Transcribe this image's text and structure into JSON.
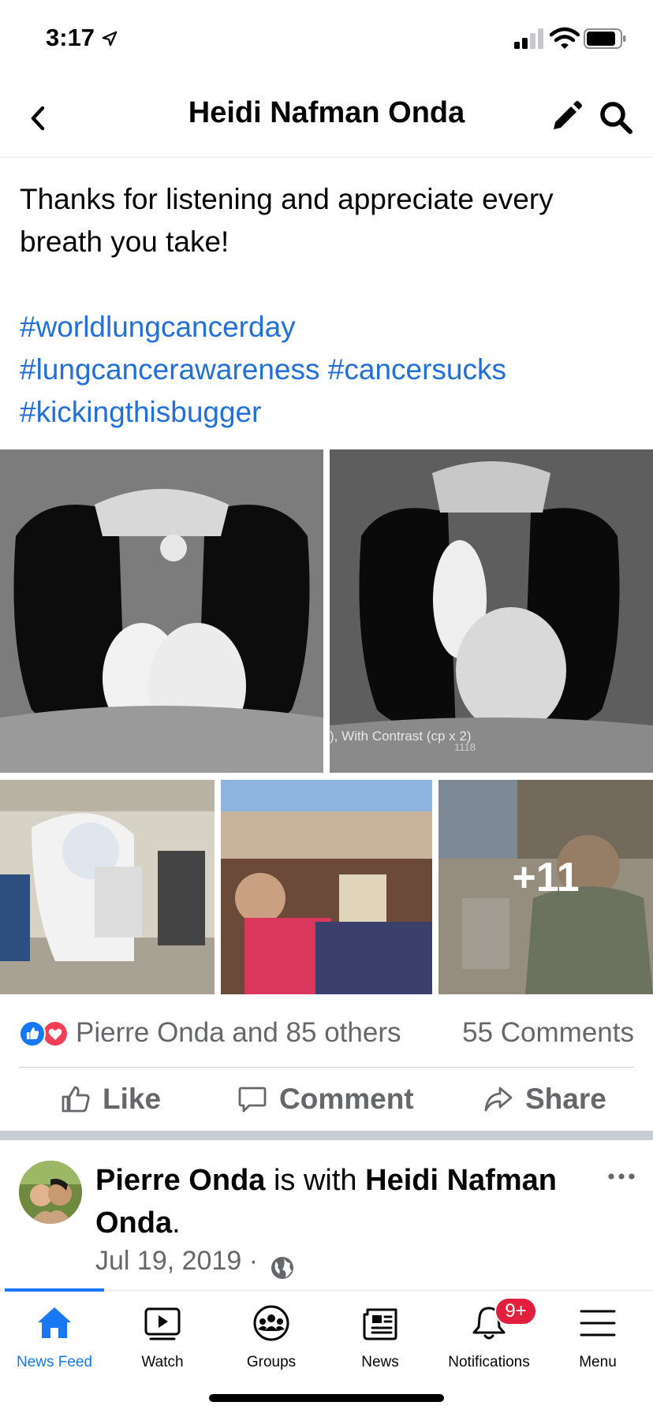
{
  "status_bar": {
    "time": "3:17",
    "icons": [
      "location-arrow-icon",
      "cellular-signal-icon",
      "wifi-icon",
      "battery-icon"
    ]
  },
  "header": {
    "title": "Heidi Nafman Onda",
    "back_icon": "chevron-left-icon",
    "edit_icon": "pencil-icon",
    "search_icon": "search-icon"
  },
  "post": {
    "text_lines": [
      "Thanks for listening and appreciate every",
      "breath you take!"
    ],
    "hashtags": {
      "line1": [
        "#worldlungcancerday"
      ],
      "line2": [
        "#lungcancerawareness",
        "#cancersucks"
      ],
      "line3": [
        "#kickingthisbugger"
      ]
    },
    "photos": {
      "ct_caption": "), With Contrast (cp x 2)",
      "ct_caption_sub": "1118",
      "more_count": "+11"
    },
    "reactions": {
      "reactors": "Pierre Onda and 85 others",
      "comments": "55 Comments"
    },
    "actions": {
      "like": "Like",
      "comment": "Comment",
      "share": "Share"
    }
  },
  "post2": {
    "author": "Pierre Onda",
    "with_text": "is with",
    "tagged": "Heidi Nafman Onda",
    "period": ".",
    "date": "Jul 19, 2019 ·",
    "privacy_icon": "globe-icon"
  },
  "tabbar": {
    "tabs": [
      {
        "label": "News Feed",
        "icon": "home-icon",
        "active": true
      },
      {
        "label": "Watch",
        "icon": "watch-play-icon"
      },
      {
        "label": "Groups",
        "icon": "groups-icon"
      },
      {
        "label": "News",
        "icon": "news-icon"
      },
      {
        "label": "Notifications",
        "icon": "bell-icon",
        "badge": "9+"
      },
      {
        "label": "Menu",
        "icon": "hamburger-menu-icon"
      }
    ]
  },
  "colors": {
    "link_blue": "#216fdb",
    "facebook_blue": "#1877f2",
    "secondary_text": "#65676b",
    "badge_red": "#e41e3f"
  }
}
